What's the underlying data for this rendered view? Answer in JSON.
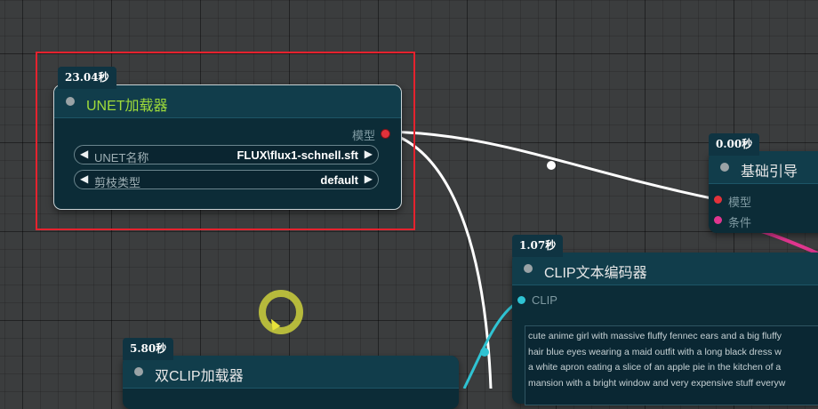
{
  "nodes": {
    "unet_loader": {
      "time": "23.04秒",
      "title": "UNET加载器",
      "title_color": "#9fdc3a",
      "output_label": "模型",
      "widgets": [
        {
          "label": "UNET名称",
          "value": "FLUX\\flux1-schnell.sft"
        },
        {
          "label": "剪枝类型",
          "value": "default"
        }
      ]
    },
    "basic_guider": {
      "time": "0.00秒",
      "title": "基础引导",
      "inputs": [
        "模型",
        "条件"
      ]
    },
    "clip_text_encode": {
      "time": "1.07秒",
      "title": "CLIP文本编码器",
      "input_label": "CLIP",
      "text_lines": [
        "cute anime girl with massive fluffy fennec ears and a big fluffy",
        "hair blue eyes wearing a maid outfit with a long black dress w",
        "a white apron eating a slice of an apple pie in the kitchen of a",
        "mansion with a bright window and very expensive stuff everyw"
      ]
    },
    "dual_clip_loader": {
      "time": "5.80秒",
      "title": "双CLIP加载器"
    }
  },
  "colors": {
    "selection": "#e5222e",
    "model_socket": "#e2323b",
    "conditioning_socket": "#e0368f",
    "clip_socket": "#2fc3d3",
    "wire": "#ffffff"
  },
  "icons": {
    "arrow_left": "◀",
    "arrow_right": "▶"
  }
}
